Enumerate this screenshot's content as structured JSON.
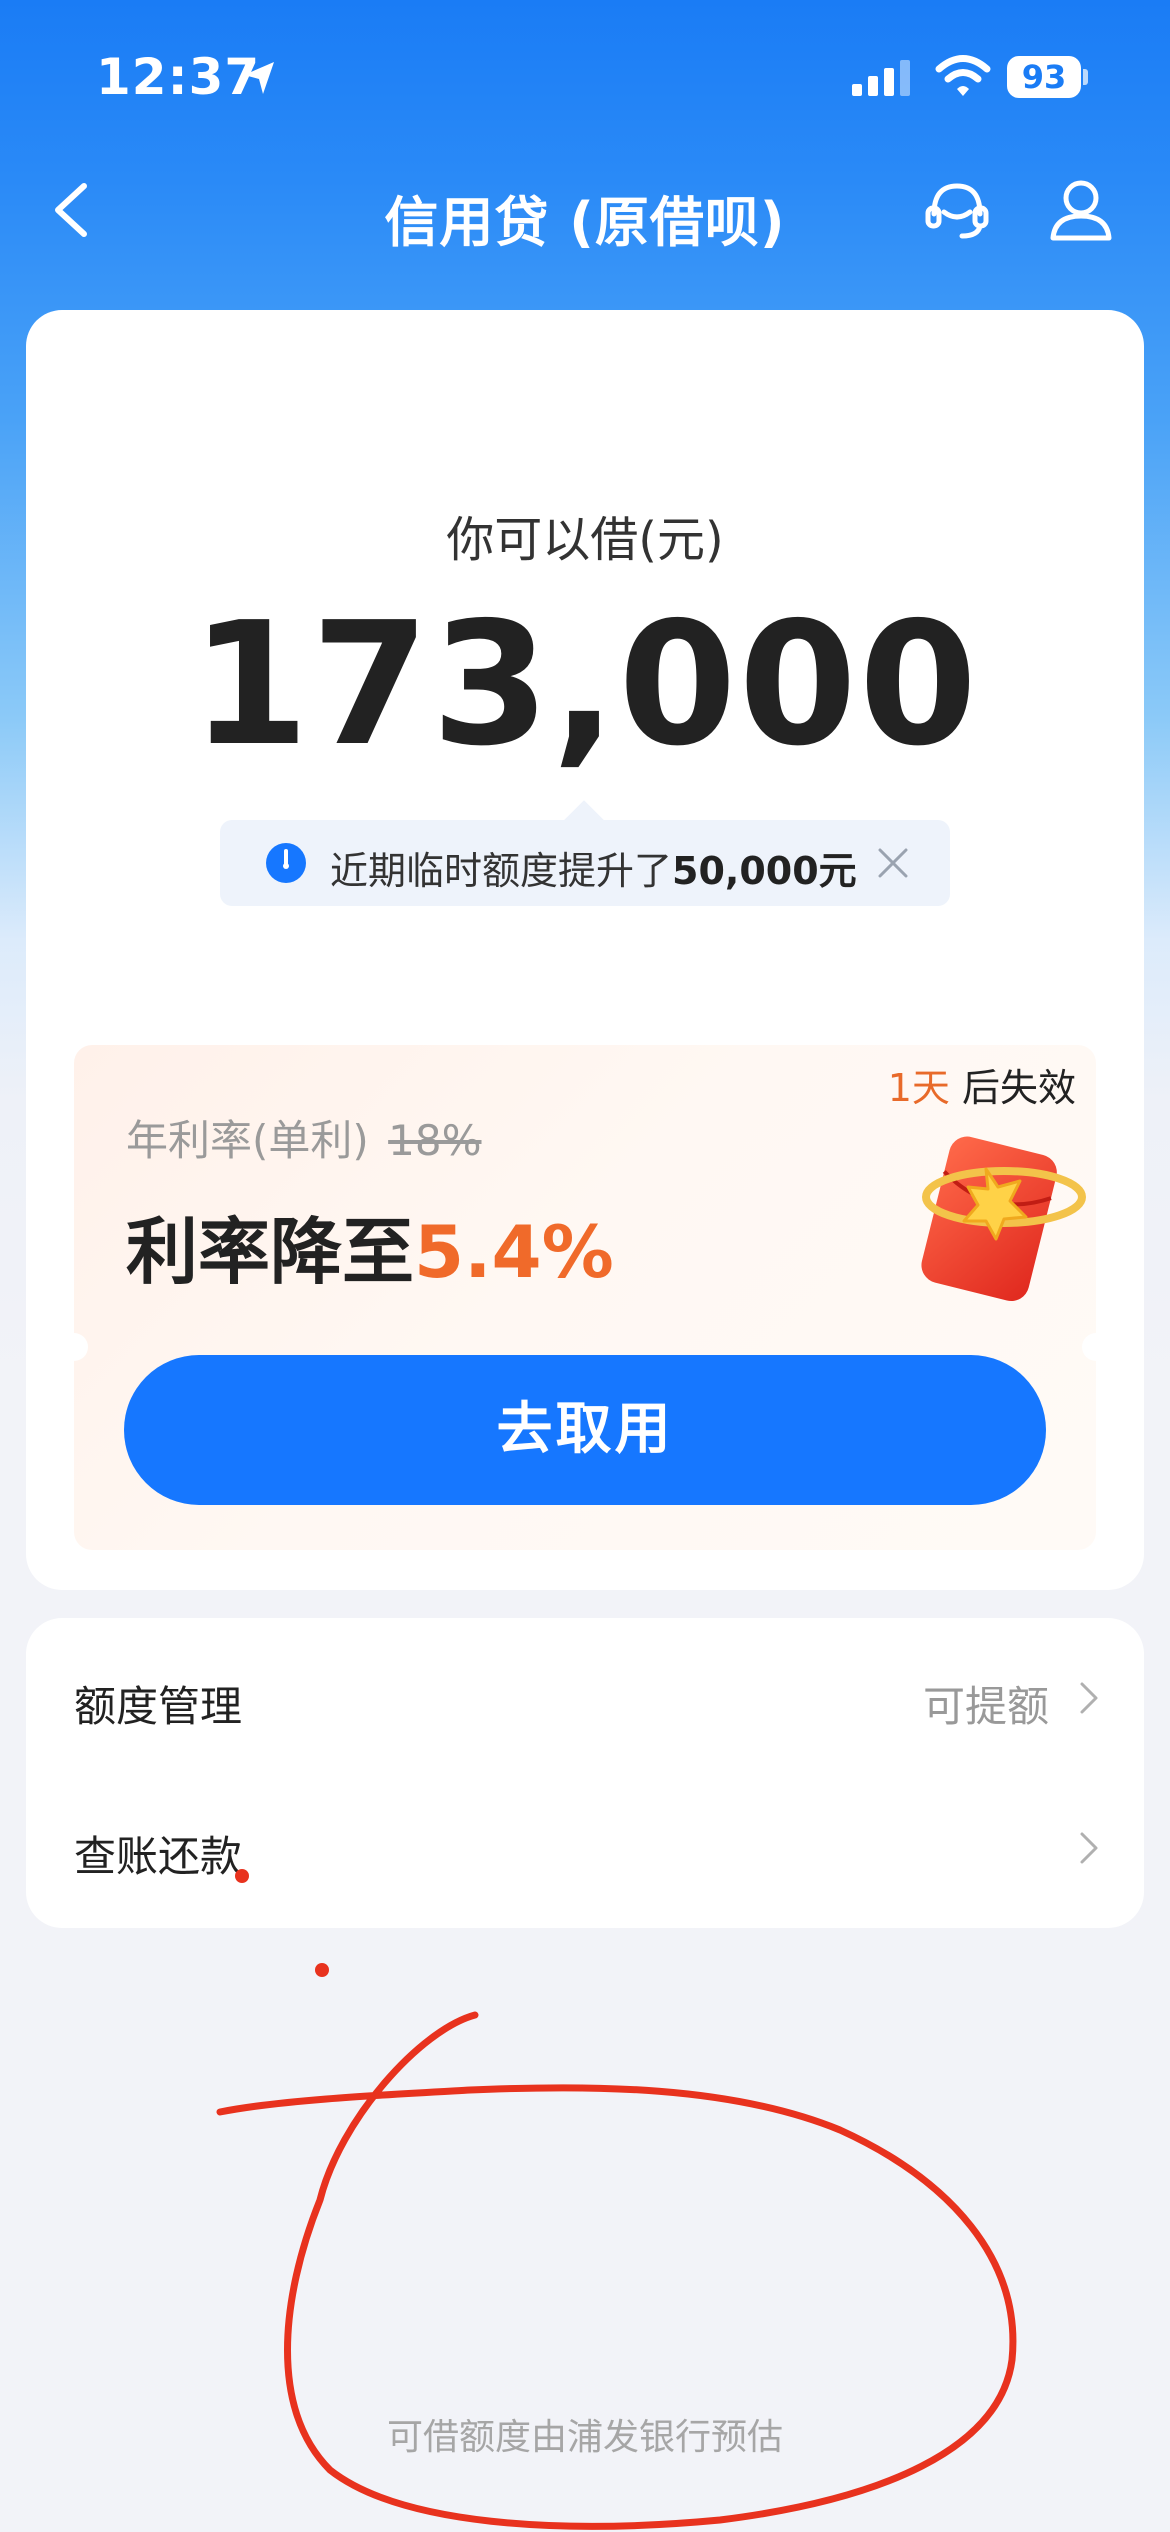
{
  "status_bar": {
    "time": "12:37",
    "battery": "93"
  },
  "nav": {
    "title": "信用贷 (原借呗)"
  },
  "credit": {
    "label": "你可以借(元)",
    "amount": "173,000",
    "notice_text": "近期临时额度提升了",
    "notice_amount": "50,000元"
  },
  "promo": {
    "expiry_days": "1天",
    "expiry_suffix": " 后失效",
    "rate_label": "年利率(单利)",
    "old_rate": "18%",
    "headline_prefix": "利率降至",
    "new_rate": "5.4%",
    "button_label": "去取用"
  },
  "menu": {
    "items": [
      {
        "label": "额度管理",
        "value": "可提额"
      },
      {
        "label": "查账还款",
        "value": ""
      }
    ]
  },
  "footer": {
    "text": "可借额度由浦发银行预估"
  },
  "colors": {
    "primary_blue": "#1677ff",
    "accent_orange": "#f06a2a",
    "annotation_red": "#e8321e"
  },
  "icons": [
    "location-arrow-icon",
    "signal-icon",
    "wifi-icon",
    "back-icon",
    "customer-service-icon",
    "user-icon",
    "clock-icon",
    "close-icon",
    "red-packet-icon",
    "chevron-right-icon"
  ]
}
